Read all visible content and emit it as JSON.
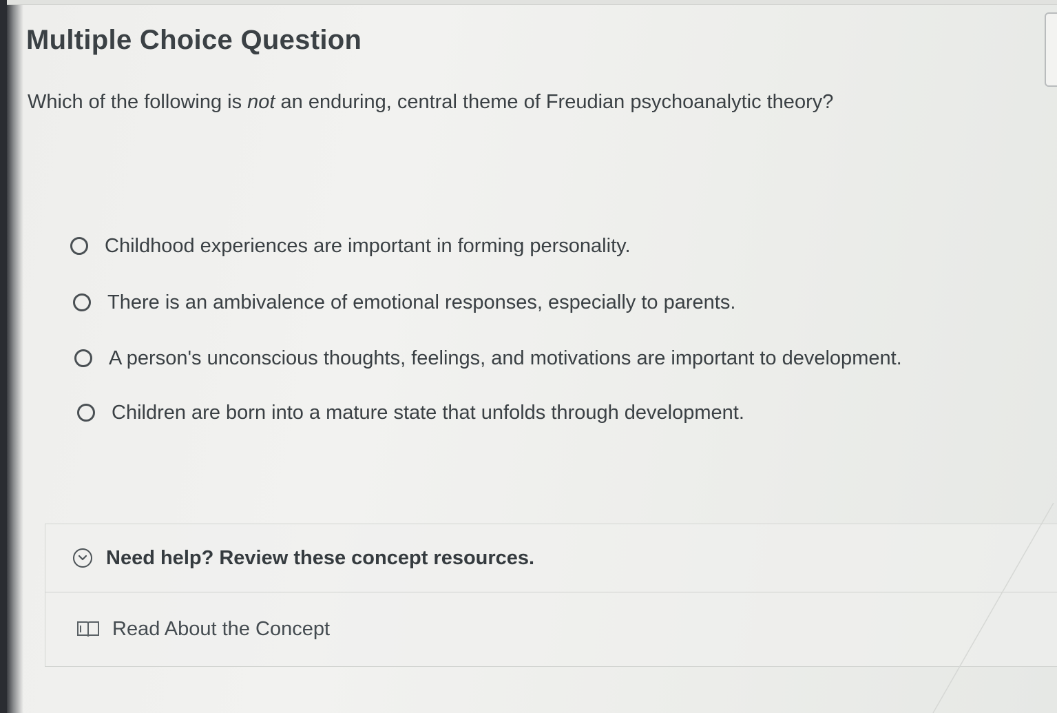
{
  "question": {
    "heading": "Multiple Choice Question",
    "prompt_before": "Which of the following is ",
    "prompt_emphasis": "not",
    "prompt_after": " an enduring, central theme of Freudian psychoanalytic theory?"
  },
  "options": [
    {
      "label": "Childhood experiences are important in forming personality.",
      "selected": false
    },
    {
      "label": "There is an ambivalence of emotional responses, especially to parents.",
      "selected": false
    },
    {
      "label": "A person's unconscious thoughts, feelings, and motivations are important to development.",
      "selected": false
    },
    {
      "label": "Children are born into a mature state that unfolds through development.",
      "selected": false
    }
  ],
  "help": {
    "title": "Need help? Review these concept resources.",
    "expand_icon": "chevron-down-circle-icon",
    "resources": [
      {
        "icon": "book-icon",
        "label": "Read About the Concept"
      }
    ]
  },
  "colors": {
    "text": "#3a4044",
    "radio_border": "#4a5054",
    "panel_border": "#d3d5d2"
  }
}
